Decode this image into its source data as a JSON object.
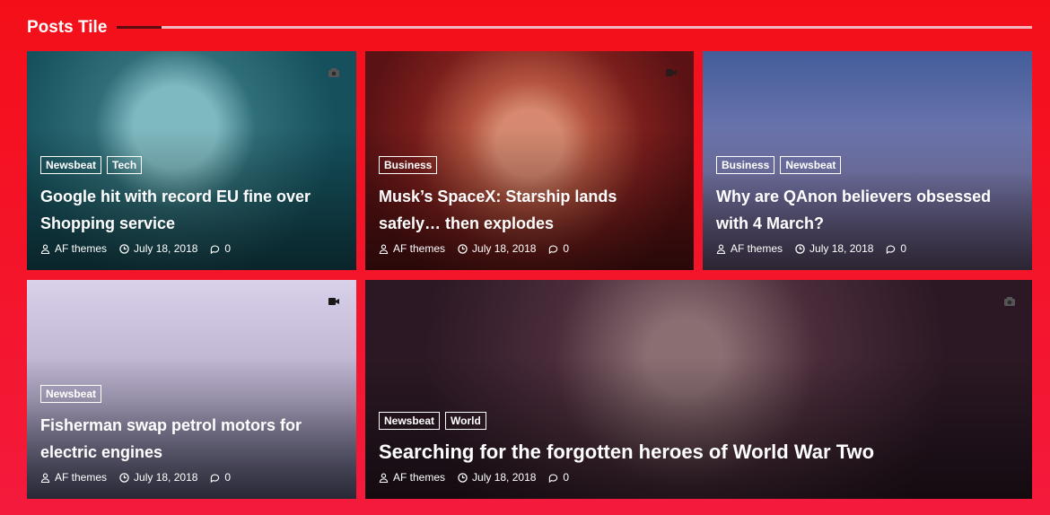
{
  "section": {
    "title": "Posts Tile"
  },
  "posts": [
    {
      "tags": [
        "Newsbeat",
        "Tech"
      ],
      "title": "Google hit with record EU fine over Shopping service",
      "author": "AF themes",
      "date": "July 18, 2018",
      "comments": "0",
      "media_icon": "camera-icon"
    },
    {
      "tags": [
        "Business"
      ],
      "title": "Musk’s SpaceX: Starship lands safely… then explodes",
      "author": "AF themes",
      "date": "July 18, 2018",
      "comments": "0",
      "media_icon": "video-icon"
    },
    {
      "tags": [
        "Business",
        "Newsbeat"
      ],
      "title": "Why are QAnon believers obsessed with 4 March?",
      "author": "AF themes",
      "date": "July 18, 2018",
      "comments": "0",
      "media_icon": ""
    },
    {
      "tags": [
        "Newsbeat"
      ],
      "title": "Fisherman swap petrol motors for electric engines",
      "author": "AF themes",
      "date": "July 18, 2018",
      "comments": "0",
      "media_icon": "video-icon"
    },
    {
      "tags": [
        "Newsbeat",
        "World"
      ],
      "title": "Searching for the forgotten heroes of World War Two",
      "author": "AF themes",
      "date": "July 18, 2018",
      "comments": "0",
      "media_icon": "camera-icon"
    }
  ],
  "colors": {
    "background_top": "#f40f18",
    "background_bottom": "#f41a3c",
    "text": "#ffffff"
  }
}
